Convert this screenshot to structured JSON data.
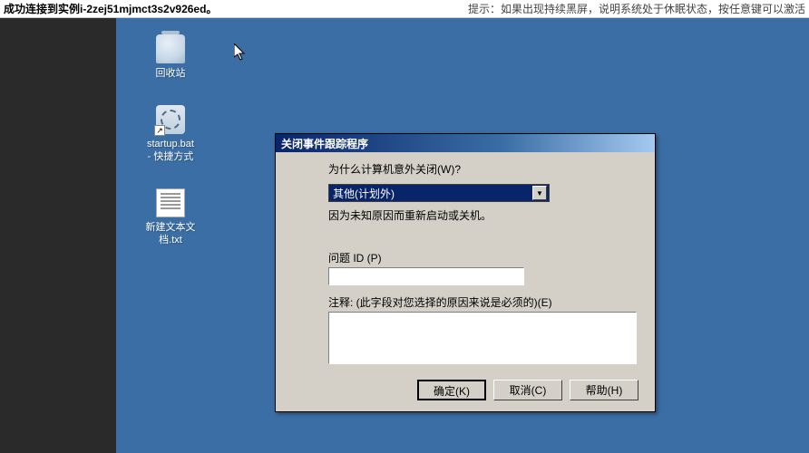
{
  "topbar": {
    "left": "成功连接到实例i-2zej51mjmct3s2v926ed。",
    "right": "提示：如果出现持续黑屏，说明系统处于休眠状态，按任意键可以激活"
  },
  "desktop": {
    "icons": [
      {
        "name": "recycle-bin",
        "label": "回收站"
      },
      {
        "name": "startup-bat",
        "label": "startup.bat\n- 快捷方式"
      },
      {
        "name": "new-txt",
        "label": "新建文本文\n档.txt"
      }
    ]
  },
  "dialog": {
    "title": "关闭事件跟踪程序",
    "question": "为什么计算机意外关闭(W)?",
    "dropdown_value": "其他(计划外)",
    "description": "因为未知原因而重新启动或关机。",
    "problem_id_label": "问题 ID (P)",
    "problem_id_value": "",
    "comment_label": "注释:  (此字段对您选择的原因来说是必须的)(E)",
    "comment_value": "",
    "buttons": {
      "ok": "确定(K)",
      "cancel": "取消(C)",
      "help": "帮助(H)"
    }
  }
}
